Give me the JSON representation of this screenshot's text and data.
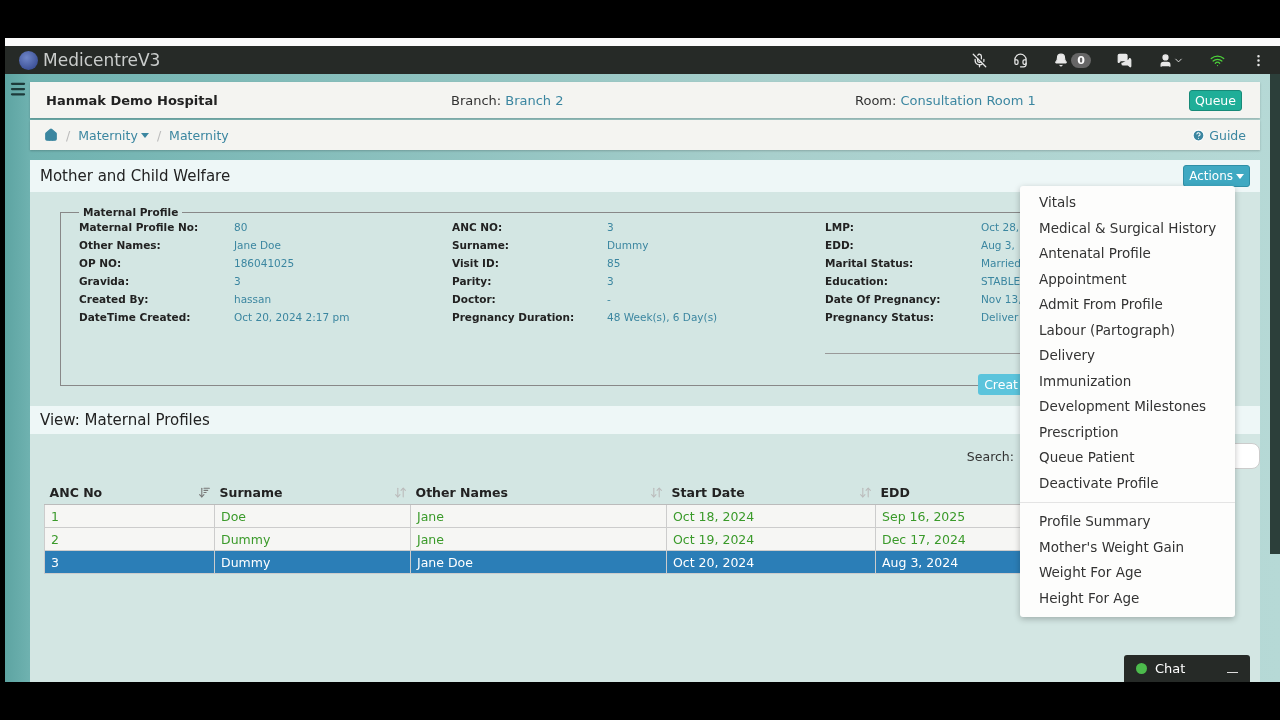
{
  "app": {
    "name": "MedicentreV3",
    "notification_count": "0",
    "wifi_connected": true
  },
  "header": {
    "hospital": "Hanmak Demo Hospital",
    "branch_label": "Branch:",
    "branch": "Branch 2",
    "room_label": "Room:",
    "room": "Consultation Room 1",
    "queue_button": "Queue"
  },
  "breadcrumbs": [
    {
      "separator": "/",
      "label": "Maternity",
      "dropdown": true
    },
    {
      "separator": "/",
      "label": "Maternity",
      "dropdown": false
    }
  ],
  "guide": "Guide",
  "panel": {
    "title": "Mother and Child Welfare",
    "actions_button": "Actions"
  },
  "profile": {
    "legend": "Maternal Profile",
    "columns": [
      [
        {
          "label": "Maternal Profile No:",
          "value": "80"
        },
        {
          "label": "Other Names:",
          "value": "Jane Doe"
        },
        {
          "label": "OP NO:",
          "value": "186041025"
        },
        {
          "label": "Gravida:",
          "value": "3"
        },
        {
          "label": "Created By:",
          "value": "hassan"
        },
        {
          "label": "DateTime Created:",
          "value": "Oct 20, 2024 2:17 pm"
        }
      ],
      [
        {
          "label": "ANC NO:",
          "value": "3"
        },
        {
          "label": "Surname:",
          "value": "Dummy"
        },
        {
          "label": "Visit ID:",
          "value": "85"
        },
        {
          "label": "Parity:",
          "value": "3"
        },
        {
          "label": "Doctor:",
          "value": "-"
        },
        {
          "label": "Pregnancy Duration:",
          "value": "48 Week(s), 6 Day(s)"
        }
      ],
      [
        {
          "label": "LMP:",
          "value": "Oct 28,"
        },
        {
          "label": "EDD:",
          "value": "Aug 3,"
        },
        {
          "label": "Marital Status:",
          "value": "Married"
        },
        {
          "label": "Education:",
          "value": "STABLE"
        },
        {
          "label": "Date Of Pregnancy:",
          "value": "Nov 13,"
        },
        {
          "label": "Pregnancy Status:",
          "value": "Deliver"
        }
      ]
    ],
    "create_button": "Creat"
  },
  "list": {
    "title": "View: Maternal Profiles",
    "search_label": "Search:",
    "columns": [
      {
        "label": "ANC No",
        "sorted": true
      },
      {
        "label": "Surname",
        "sorted": false
      },
      {
        "label": "Other Names",
        "sorted": false
      },
      {
        "label": "Start Date",
        "sorted": false
      },
      {
        "label": "EDD"
      }
    ],
    "rows": [
      {
        "cells": [
          "1",
          "Doe",
          "Jane",
          "Oct 18, 2024",
          "Sep 16, 2025"
        ],
        "selected": false
      },
      {
        "cells": [
          "2",
          "Dummy",
          "Jane",
          "Oct 19, 2024",
          "Dec 17, 2024"
        ],
        "selected": false
      },
      {
        "cells": [
          "3",
          "Dummy",
          "Jane Doe",
          "Oct 20, 2024",
          "Aug 3, 2024"
        ],
        "selected": true
      }
    ]
  },
  "menu": {
    "groups": [
      [
        "Vitals",
        "Medical & Surgical History",
        "Antenatal Profile",
        "Appointment",
        "Admit From Profile",
        "Labour (Partograph)",
        "Delivery",
        "Immunization",
        "Development Milestones",
        "Prescription",
        "Queue Patient",
        "Deactivate Profile"
      ],
      [
        "Profile Summary",
        "Mother's Weight Gain",
        "Weight For Age",
        "Height For Age"
      ]
    ]
  },
  "chat": {
    "label": "Chat",
    "online": true
  }
}
